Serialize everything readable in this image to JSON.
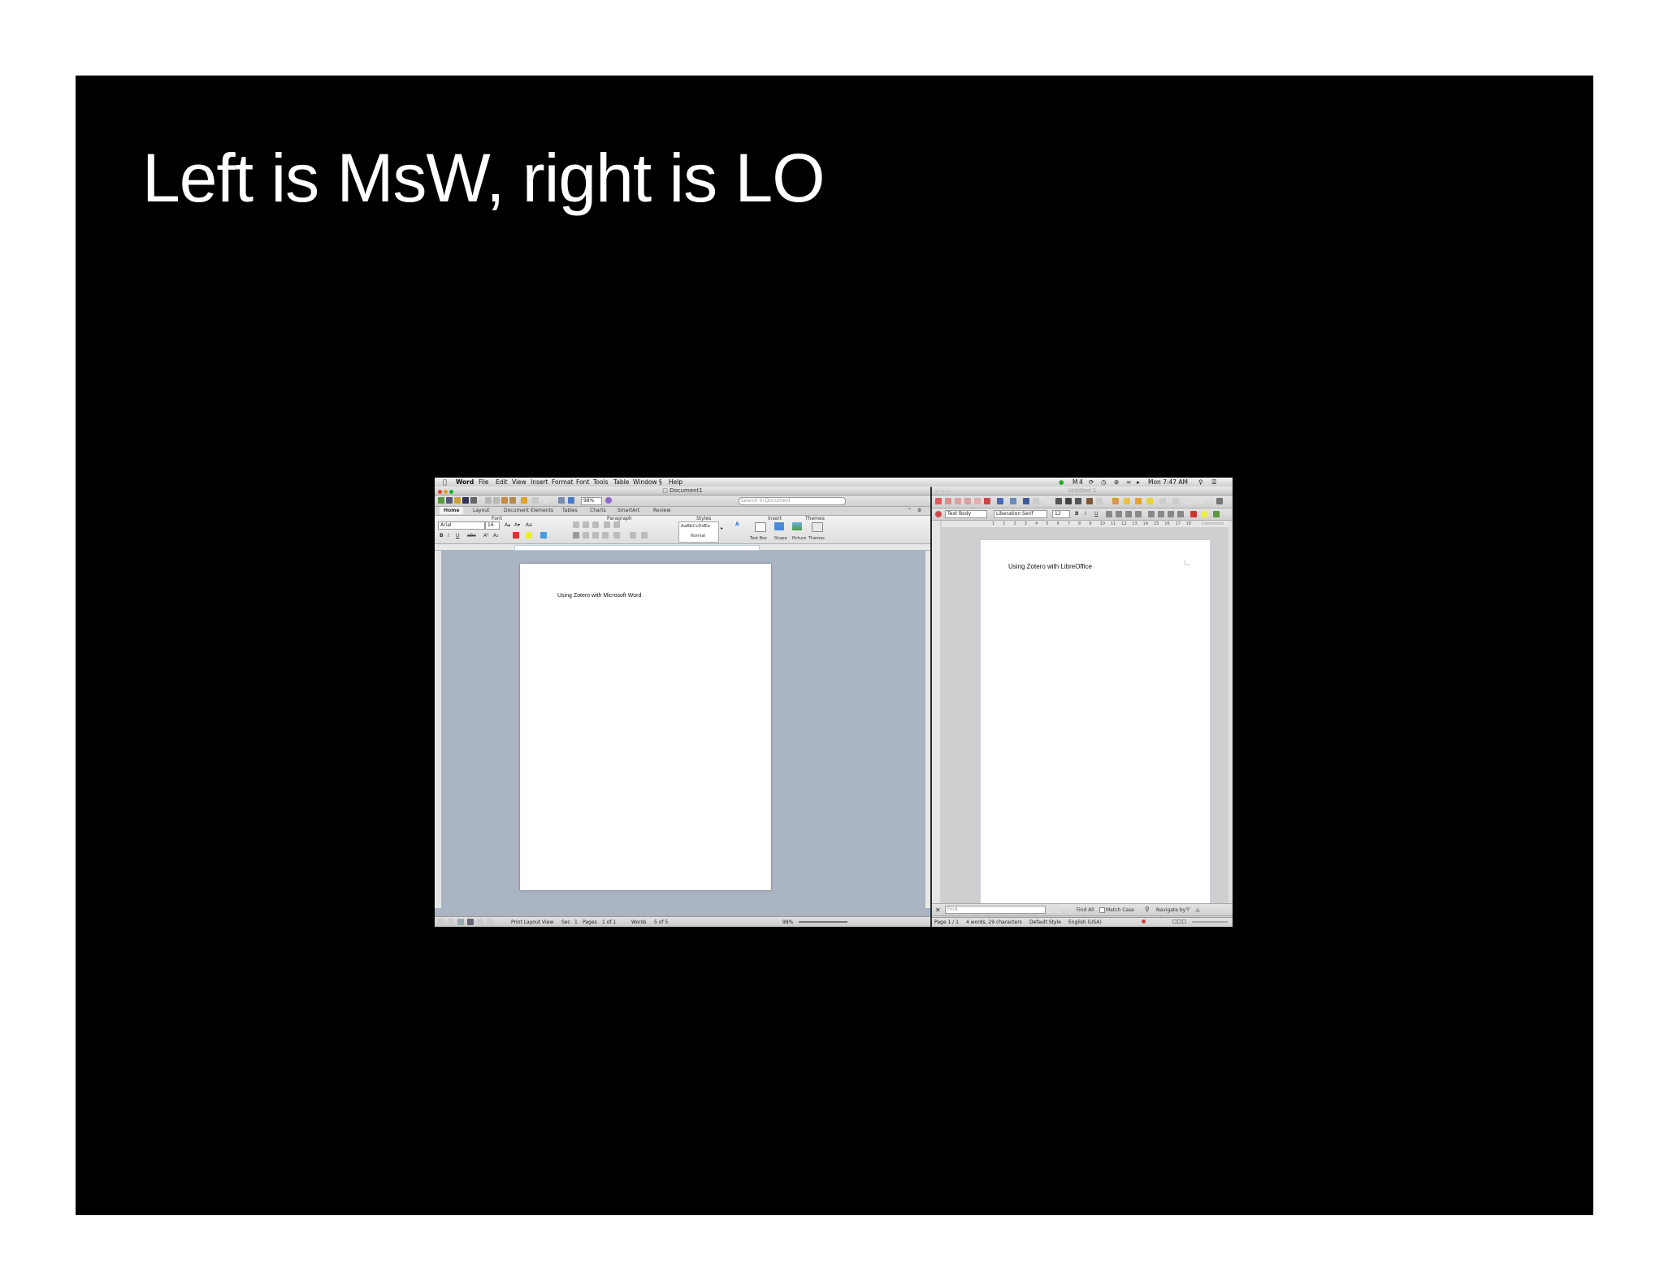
{
  "slide": {
    "title": "Left is MsW, right is LO"
  },
  "mac_menubar": {
    "app": "Word",
    "items": [
      "File",
      "Edit",
      "View",
      "Insert",
      "Format",
      "Font",
      "Tools",
      "Table",
      "Window",
      "Help"
    ],
    "clock": "Mon 7:47 AM",
    "battery": "4"
  },
  "word": {
    "window_title": "Document1",
    "search_placeholder": "Search in Document",
    "zoom": "98%",
    "ribbon_tabs": [
      "Home",
      "Layout",
      "Document Elements",
      "Tables",
      "Charts",
      "SmartArt",
      "Review"
    ],
    "group_labels": {
      "font": "Font",
      "paragraph": "Paragraph",
      "styles": "Styles",
      "insert": "Insert",
      "themes": "Themes"
    },
    "font_name": "Arial",
    "font_size": "16",
    "style_preview": "AaBbCcDdEe",
    "style_name": "Normal",
    "insert_buttons": [
      "Text Box",
      "Shape",
      "Picture"
    ],
    "themes_button": "Themes",
    "document_text": "Using Zotero with Microsoft Word",
    "status": {
      "view": "Print Layout View",
      "sec_label": "Sec",
      "sec": "1",
      "pages_label": "Pages",
      "pages": "1 of 1",
      "words_label": "Words",
      "words": "5 of 5",
      "zoom": "98%"
    }
  },
  "libreoffice": {
    "window_title": "Untitled 1",
    "paragraph_style": "Text Body",
    "font_name": "Liberation Serif",
    "font_size": "12",
    "ruler_numbers": [
      "1",
      "1",
      "2",
      "3",
      "4",
      "5",
      "6",
      "7",
      "8",
      "9",
      "10",
      "11",
      "12",
      "13",
      "14",
      "15",
      "16",
      "17",
      "18"
    ],
    "comments_label": "Comments",
    "document_text": "Using Zotero with LibreOffice",
    "find_placeholder": "Find",
    "find_all": "Find All",
    "match_case": "Match Case",
    "navigate_by": "Navigate by",
    "status": {
      "page": "Page 1 / 1",
      "counts": "4 words, 29 characters",
      "style": "Default Style",
      "language": "English (USA)"
    }
  },
  "colors": {
    "slide_bg": "#000000",
    "word_canvas": "#aab4c2",
    "lo_canvas": "#cfcfd2",
    "close": "#e0443e",
    "minimize": "#dea123",
    "zoom": "#1aab29"
  }
}
